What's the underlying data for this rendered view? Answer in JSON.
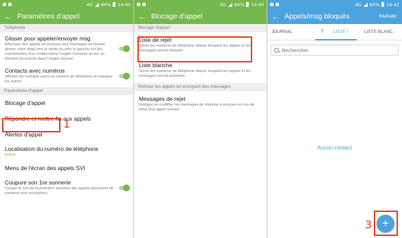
{
  "status": {
    "left_icons": [
      "notification-icon",
      "notification-icon"
    ],
    "right_text_p1": "84%",
    "time_p1": "14:40",
    "right_text_p2": "84%",
    "time_p2": "14:40",
    "right_text_p3": "84%",
    "time_p3": "14:42",
    "network_label": "4G"
  },
  "panel1": {
    "title": "Paramètres d'appel",
    "section_phone": "Téléphone",
    "items": [
      {
        "title": "Glisser pour appeler/envoyer msg",
        "subtitle": "Effectuez des appels ou envoyez des messages en faisant glisser votre doigt vers la droite ou vers la gauche sur les coordonnées d'un contact dans l'onglet Contacts ou sur un élément du journal dans l'onglet Journal."
      },
      {
        "title": "Contacts avec numéros",
        "subtitle": "Afficher les contacts ayant un numéro de téléphone et masquer les autres."
      }
    ],
    "section_call": "Paramètres d'appel",
    "items2": [
      {
        "title": "Blocage d'appel"
      },
      {
        "title": "Répondre et mettre fin aux appels"
      },
      {
        "title": "Alertes d'appel"
      },
      {
        "title": "Localisation du numéro de téléphone",
        "subtitle": "Activé"
      },
      {
        "title": "Menu de l'écran des appels SVI"
      },
      {
        "title": "Coupure son 1re sonnerie",
        "subtitle": "Couper le son de la première sonnerie des appels provenant de numéros non enregistrés."
      }
    ],
    "step": "1"
  },
  "panel2": {
    "title": "Blocage d'appel",
    "section_block": "Blocage d'appel",
    "items": [
      {
        "title": "Liste de rejet",
        "subtitle": "Gérez les numéros de téléphone depuis lesquels les appels et les messages seront bloqués."
      },
      {
        "title": "Liste blanche",
        "subtitle": "Gérez les numéros de téléphone depuis lesquels les appels et les messages seront autorisés."
      }
    ],
    "section_refuse": "Refuser les appels en envoyant des messages",
    "items2": [
      {
        "title": "Messages de rejet",
        "subtitle": "Rédigez ou modifiez les messages de réponse à envoyer en cas de refus d'un appel entrant."
      }
    ],
    "step": "2"
  },
  "panel3": {
    "title": "Appels/msg bloqués",
    "action": "PARAM.",
    "tabs": [
      "JOURNAL",
      "T",
      "LISTE I",
      "LISTE BLANC."
    ],
    "search_placeholder": "Rechercher",
    "empty_text": "Aucun contact",
    "fab_label": "+",
    "step": "3"
  },
  "colors": {
    "green_header": "#75b84e",
    "blue_header": "#4da3dd",
    "highlight": "#e3421e"
  }
}
